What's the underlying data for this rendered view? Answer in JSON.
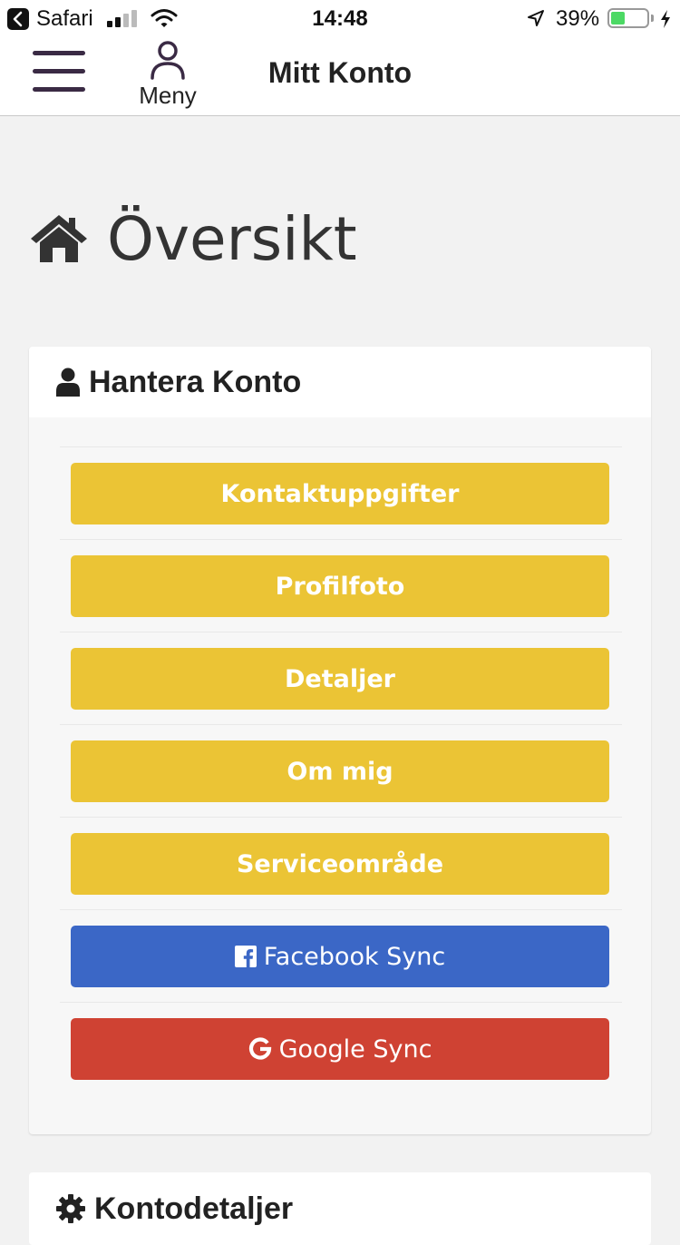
{
  "status_bar": {
    "back_app": "Safari",
    "time": "14:48",
    "battery_percent": "39%",
    "battery_level": 0.39,
    "signal_bars_active": 2,
    "signal_bars_total": 4
  },
  "nav": {
    "menu_label": "Meny",
    "title": "Mitt Konto"
  },
  "page": {
    "heading": "Översikt",
    "heading_icon": "home-icon"
  },
  "manage_card": {
    "title": "Hantera Konto",
    "title_icon": "user-icon",
    "buttons": [
      {
        "label": "Kontaktuppgifter",
        "color": "#ebc435"
      },
      {
        "label": "Profilfoto",
        "color": "#ebc435"
      },
      {
        "label": "Detaljer",
        "color": "#ebc435"
      },
      {
        "label": "Om mig",
        "color": "#ebc435"
      },
      {
        "label": "Serviceområde",
        "color": "#ebc435"
      },
      {
        "label": "Facebook Sync",
        "color": "#3b67c6",
        "icon": "facebook-icon"
      },
      {
        "label": "Google Sync",
        "color": "#cf4233",
        "icon": "google-icon"
      }
    ]
  },
  "details_card": {
    "title": "Kontodetaljer",
    "title_icon": "gear-icon"
  }
}
